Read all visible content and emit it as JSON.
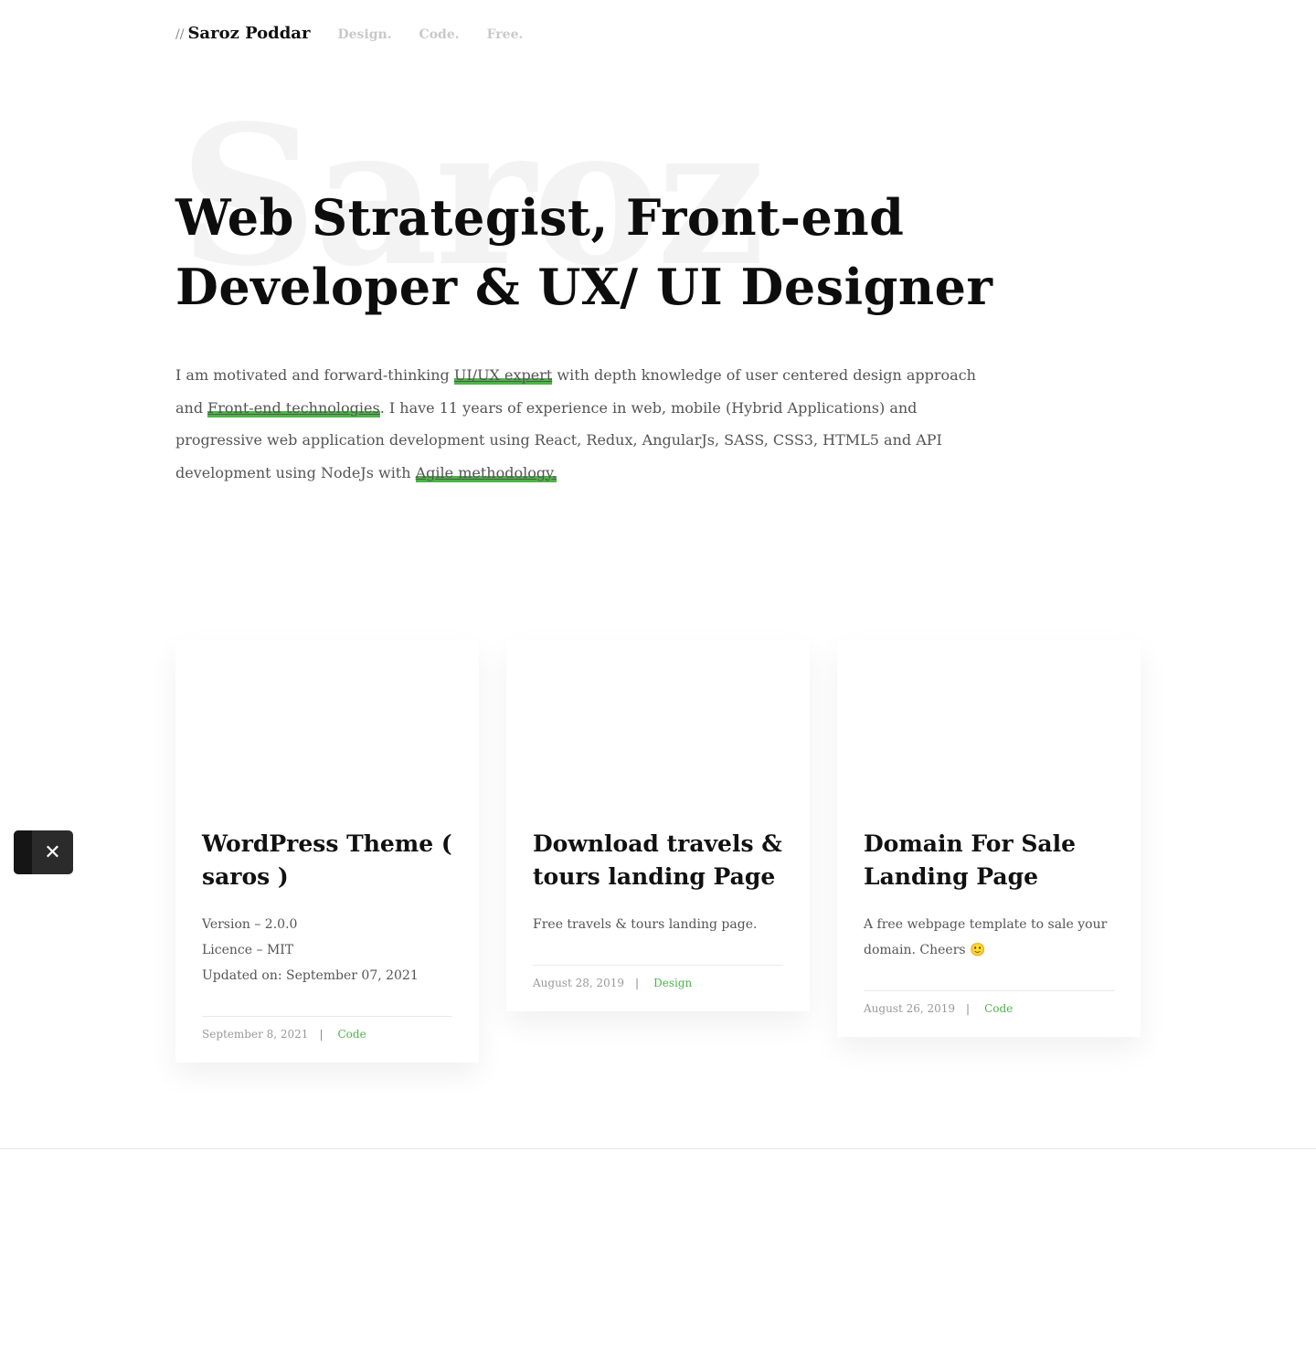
{
  "header": {
    "brand_prefix": "//",
    "brand_name": "Saroz Poddar",
    "nav": [
      "Design.",
      "Code.",
      "Free."
    ]
  },
  "hero": {
    "background_word": "Saroz",
    "title_line1": "Web Strategist, Front-end",
    "title_line2": "Developer & UX/ UI Designer"
  },
  "intro": {
    "t1": "I am motivated and forward-thinking ",
    "link1": "UI/UX expert",
    "t2": " with depth knowledge of user centered design approach and ",
    "link2": "Front-end technologies",
    "t3": ". I have 11 years of experience in web, mobile (Hybrid Applications) and progressive web application development using React, Redux, AngularJs, SASS, CSS3, HTML5 and API development using NodeJs with ",
    "link3": "Agile methodology."
  },
  "cards": [
    {
      "title": "WordPress Theme ( saros )",
      "desc_lines": [
        "Version – 2.0.0",
        "Licence – MIT",
        "Updated on: September 07, 2021"
      ],
      "date": "September 8, 2021",
      "category": "Code"
    },
    {
      "title": "Download travels & tours landing Page",
      "desc_lines": [
        "Free travels & tours landing page."
      ],
      "date": "August 28, 2019",
      "category": "Design"
    },
    {
      "title": "Domain For Sale Landing Page",
      "desc_lines": [
        "A free webpage template to sale your domain. Cheers 🙂"
      ],
      "date": "August 26, 2019",
      "category": "Code"
    }
  ],
  "meta_separator": "|",
  "close_icon_glyph": "✕",
  "colors": {
    "accent": "#4cb547",
    "text": "#111111",
    "muted": "#555555",
    "nav": "#c9c9c9"
  }
}
